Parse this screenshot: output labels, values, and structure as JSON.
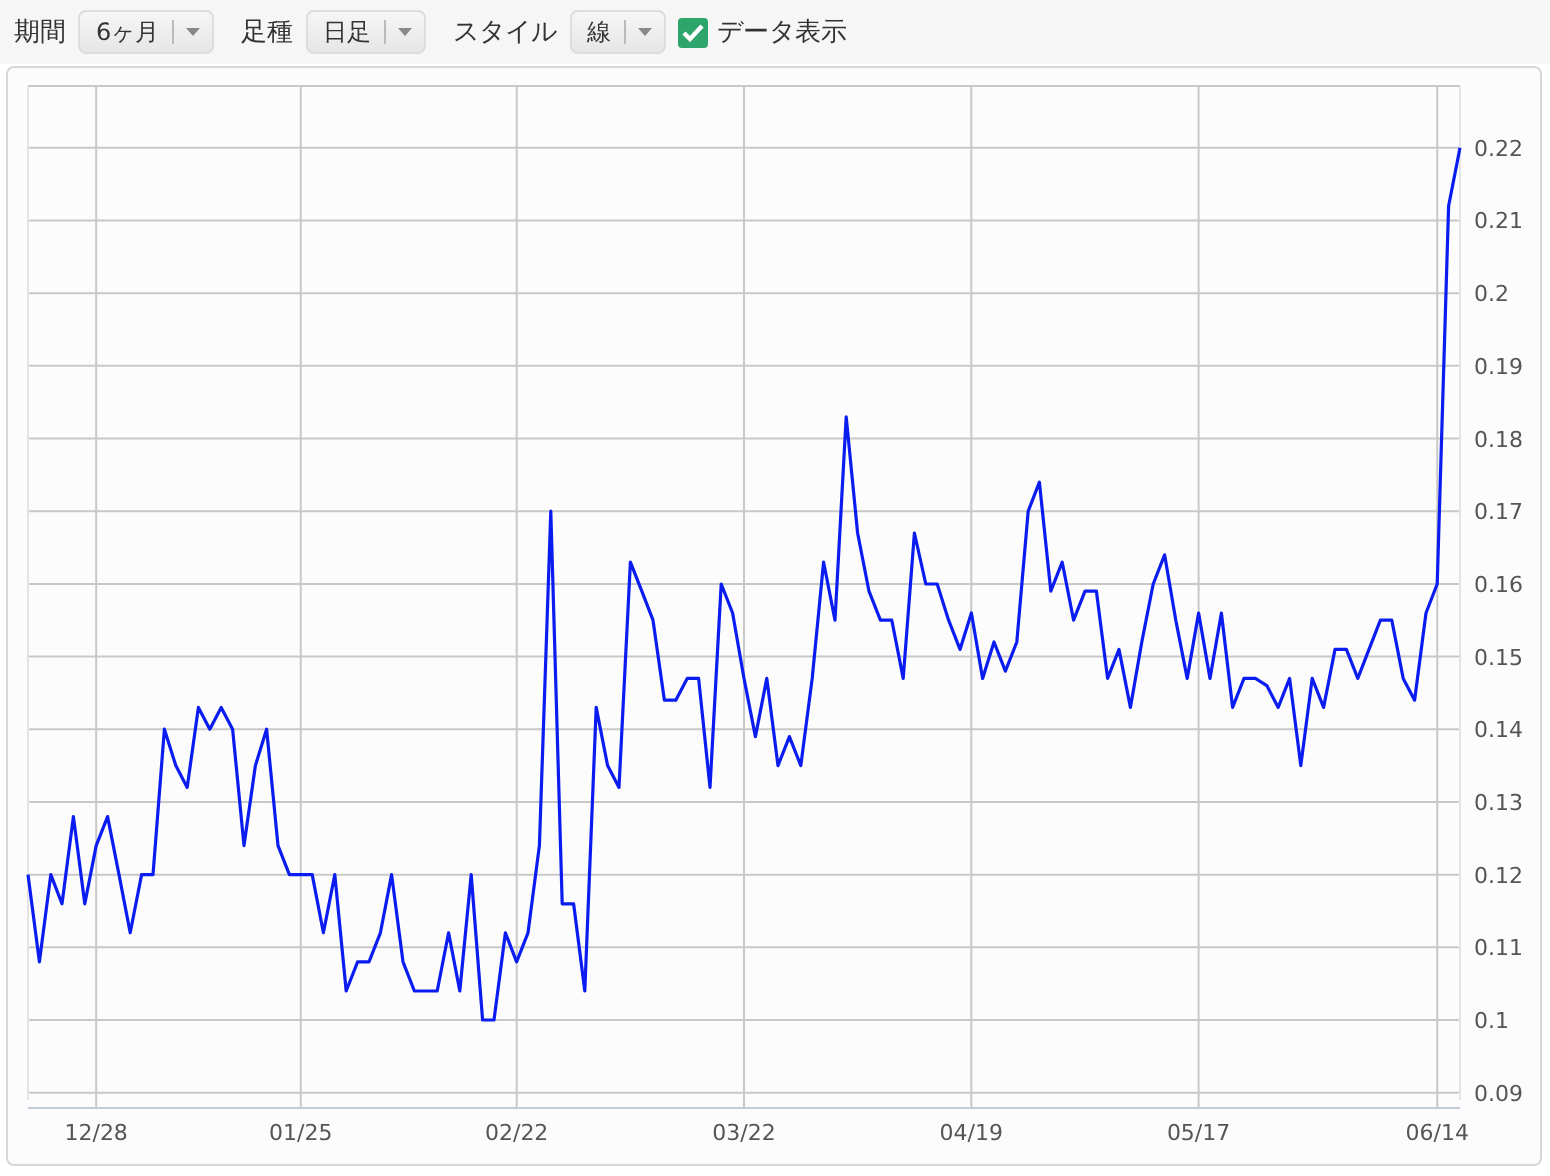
{
  "toolbar": [
    {
      "kind": "label",
      "text": "期間"
    },
    {
      "kind": "dropdown",
      "value": "6ヶ月"
    },
    {
      "kind": "label",
      "text": "足種"
    },
    {
      "kind": "dropdown",
      "value": "日足"
    },
    {
      "kind": "label",
      "text": "スタイル"
    },
    {
      "kind": "dropdown",
      "value": "線"
    },
    {
      "kind": "checkbox",
      "label": "データ表示",
      "checked": true
    }
  ],
  "chart_data": {
    "type": "line",
    "grid": true,
    "ylim": [
      0.089,
      0.2285
    ],
    "categories": [
      null,
      null,
      null,
      null,
      null,
      null,
      "12/28",
      null,
      null,
      null,
      null,
      null,
      null,
      null,
      null,
      null,
      null,
      null,
      null,
      null,
      null,
      null,
      null,
      null,
      "01/25",
      null,
      null,
      null,
      null,
      null,
      null,
      null,
      null,
      null,
      null,
      null,
      null,
      null,
      null,
      null,
      null,
      null,
      null,
      "02/22",
      null,
      null,
      null,
      null,
      null,
      null,
      null,
      null,
      null,
      null,
      null,
      null,
      null,
      null,
      null,
      null,
      null,
      null,
      null,
      "03/22",
      null,
      null,
      null,
      null,
      null,
      null,
      null,
      null,
      null,
      null,
      null,
      null,
      null,
      null,
      null,
      null,
      null,
      null,
      null,
      "04/19",
      null,
      null,
      null,
      null,
      null,
      null,
      null,
      null,
      null,
      null,
      null,
      null,
      null,
      null,
      null,
      null,
      null,
      null,
      null,
      "05/17",
      null,
      null,
      null,
      null,
      null,
      null,
      null,
      null,
      null,
      null,
      null,
      null,
      null,
      null,
      null,
      null,
      null,
      null,
      null,
      null,
      "06/14",
      null,
      null
    ],
    "yticks": [
      {
        "value": 0.09,
        "label": "0.09"
      },
      {
        "value": 0.1,
        "label": "0.1"
      },
      {
        "value": 0.11,
        "label": "0.11"
      },
      {
        "value": 0.12,
        "label": "0.12"
      },
      {
        "value": 0.13,
        "label": "0.13"
      },
      {
        "value": 0.14,
        "label": "0.14"
      },
      {
        "value": 0.15,
        "label": "0.15"
      },
      {
        "value": 0.16,
        "label": "0.16"
      },
      {
        "value": 0.17,
        "label": "0.17"
      },
      {
        "value": 0.18,
        "label": "0.18"
      },
      {
        "value": 0.19,
        "label": "0.19"
      },
      {
        "value": 0.2,
        "label": "0.2"
      },
      {
        "value": 0.21,
        "label": "0.21"
      },
      {
        "value": 0.22,
        "label": "0.22"
      }
    ],
    "series": [
      {
        "color": "#0a1cf0",
        "values": [
          0.12,
          0.108,
          0.12,
          0.116,
          0.128,
          0.116,
          0.124,
          0.128,
          0.12,
          0.112,
          0.12,
          0.12,
          0.14,
          0.135,
          0.132,
          0.143,
          0.14,
          0.143,
          0.14,
          0.124,
          0.135,
          0.14,
          0.124,
          0.12,
          0.12,
          0.12,
          0.112,
          0.12,
          0.104,
          0.108,
          0.108,
          0.112,
          0.12,
          0.108,
          0.104,
          0.104,
          0.104,
          0.112,
          0.104,
          0.12,
          0.1,
          0.1,
          0.112,
          0.108,
          0.112,
          0.124,
          0.17,
          0.116,
          0.116,
          0.104,
          0.143,
          0.135,
          0.132,
          0.163,
          0.159,
          0.155,
          0.144,
          0.144,
          0.147,
          0.147,
          0.132,
          0.16,
          0.156,
          0.147,
          0.139,
          0.147,
          0.135,
          0.139,
          0.135,
          0.147,
          0.163,
          0.155,
          0.183,
          0.167,
          0.159,
          0.155,
          0.155,
          0.147,
          0.167,
          0.16,
          0.16,
          0.155,
          0.151,
          0.156,
          0.147,
          0.152,
          0.148,
          0.152,
          0.17,
          0.174,
          0.159,
          0.163,
          0.155,
          0.159,
          0.159,
          0.147,
          0.151,
          0.143,
          0.152,
          0.16,
          0.164,
          0.155,
          0.147,
          0.156,
          0.147,
          0.156,
          0.143,
          0.147,
          0.147,
          0.146,
          0.143,
          0.147,
          0.135,
          0.147,
          0.143,
          0.151,
          0.151,
          0.147,
          0.151,
          0.155,
          0.155,
          0.147,
          0.144,
          0.156,
          0.16,
          0.212,
          0.22
        ]
      }
    ]
  }
}
